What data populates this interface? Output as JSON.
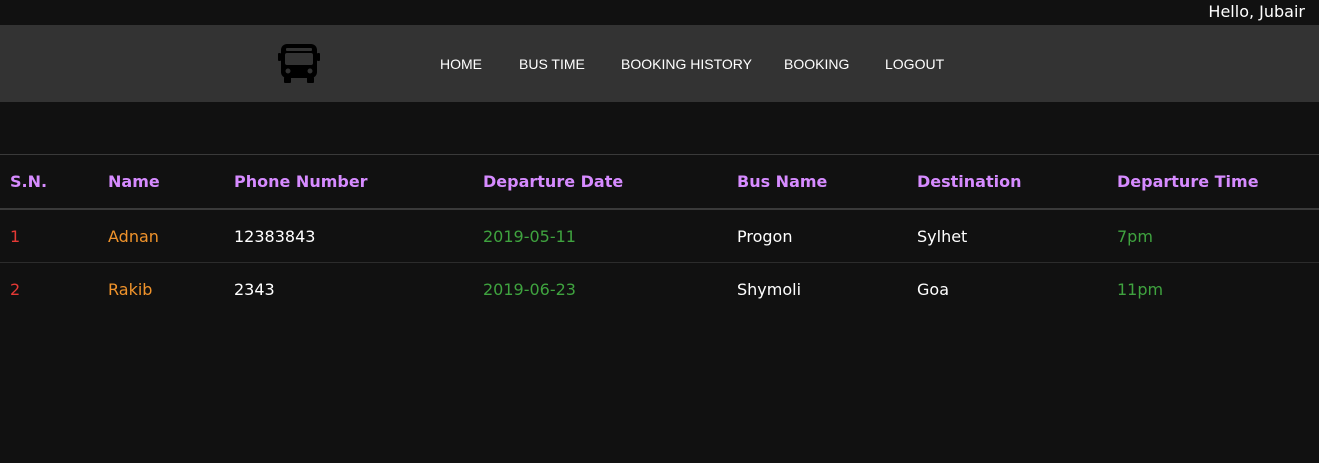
{
  "header": {
    "greeting": "Hello, Jubair",
    "logo_icon": "bus-icon"
  },
  "nav": {
    "items": [
      {
        "label": "HOME"
      },
      {
        "label": "BUS TIME"
      },
      {
        "label": "BOOKING HISTORY"
      },
      {
        "label": "BOOKING"
      },
      {
        "label": "LOGOUT"
      }
    ]
  },
  "table": {
    "headers": [
      "S.N.",
      "Name",
      "Phone Number",
      "Departure Date",
      "Bus Name",
      "Destination",
      "Departure Time"
    ],
    "rows": [
      [
        "1",
        "Adnan",
        "12383843",
        "2019-05-11",
        "Progon",
        "Sylhet",
        "7pm"
      ],
      [
        "2",
        "Rakib",
        "2343",
        "2019-06-23",
        "Shymoli",
        "Goa",
        "11pm"
      ]
    ]
  },
  "colors": {
    "background": "#111111",
    "navbar": "#333333",
    "header_text": "#d68bff",
    "serial": "#e53935",
    "name": "#f0932b",
    "date_time": "#3fa33f"
  }
}
